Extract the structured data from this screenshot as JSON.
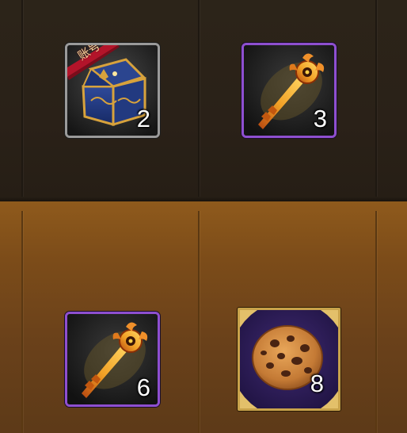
{
  "rows": [
    {
      "slots": [
        {
          "icon": "treasure-chest-icon",
          "tag": "账号",
          "count": "2",
          "frame": "#9a9a9a"
        },
        {
          "icon": "golden-key-icon",
          "count": "3",
          "frame": "#8e4fd0"
        }
      ]
    },
    {
      "slots": [
        {
          "icon": "golden-key-icon",
          "count": "6",
          "frame": "#8e4fd0"
        },
        {
          "icon": "cookie-icon",
          "count": "8",
          "frame": "#c8a24a"
        }
      ]
    }
  ],
  "colors": {
    "top_band": "#2a2118",
    "bottom_band": "#7c4c19",
    "rarity_purple": "#8e4fd0",
    "rarity_gold": "#c8a24a",
    "tag_red": "#b3142a"
  }
}
